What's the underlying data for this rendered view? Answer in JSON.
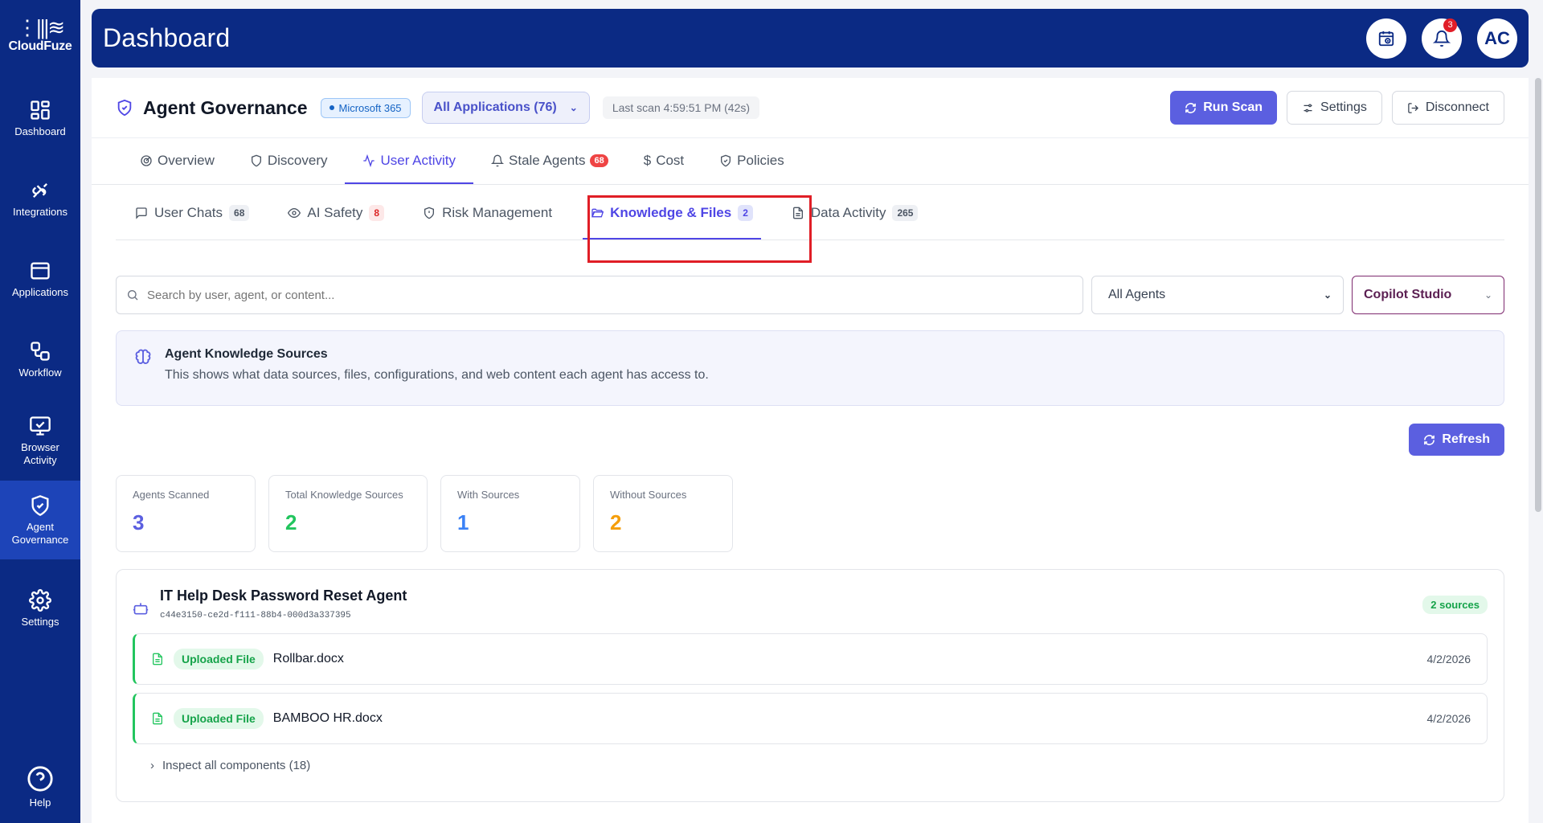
{
  "brand": {
    "name": "CloudFuze"
  },
  "sidebar": {
    "items": [
      {
        "label": "Dashboard",
        "icon": "grid-icon"
      },
      {
        "label": "Integrations",
        "icon": "plug-icon"
      },
      {
        "label": "Applications",
        "icon": "window-icon"
      },
      {
        "label": "Workflow",
        "icon": "workflow-icon"
      },
      {
        "label": "Browser Activity",
        "icon": "monitor-check-icon"
      },
      {
        "label": "Agent Governance",
        "icon": "shield-check-icon",
        "active": true
      },
      {
        "label": "Settings",
        "icon": "gear-icon"
      }
    ],
    "help": "Help"
  },
  "header": {
    "title": "Dashboard",
    "notifications": "3",
    "avatar": "AC"
  },
  "agent_bar": {
    "title": "Agent Governance",
    "platform": "Microsoft 365",
    "app_filter": "All Applications (76)",
    "last_scan": "Last scan 4:59:51 PM (42s)",
    "run_scan": "Run Scan",
    "settings": "Settings",
    "disconnect": "Disconnect"
  },
  "tabs": [
    {
      "label": "Overview"
    },
    {
      "label": "Discovery"
    },
    {
      "label": "User Activity",
      "active": true
    },
    {
      "label": "Stale Agents",
      "badge": "68"
    },
    {
      "label": "Cost"
    },
    {
      "label": "Policies"
    }
  ],
  "subtabs": [
    {
      "label": "User Chats",
      "count": "68"
    },
    {
      "label": "AI Safety",
      "count": "8"
    },
    {
      "label": "Risk Management"
    },
    {
      "label": "Knowledge & Files",
      "count": "2",
      "active": true
    },
    {
      "label": "Data Activity",
      "count": "265"
    }
  ],
  "filters": {
    "search_placeholder": "Search by user, agent, or content...",
    "agent_select": "All Agents",
    "studio_select": "Copilot Studio"
  },
  "info": {
    "title": "Agent Knowledge Sources",
    "text": "This shows what data sources, files, configurations, and web content each agent has access to."
  },
  "refresh": "Refresh",
  "stats": [
    {
      "label": "Agents Scanned",
      "value": "3",
      "color": "#5b5fe0"
    },
    {
      "label": "Total Knowledge Sources",
      "value": "2",
      "color": "#22c55e"
    },
    {
      "label": "With Sources",
      "value": "1",
      "color": "#3b82f6"
    },
    {
      "label": "Without Sources",
      "value": "2",
      "color": "#f59e0b"
    }
  ],
  "agent": {
    "name": "IT Help Desk Password Reset Agent",
    "id": "c44e3150-ce2d-f111-88b4-000d3a337395",
    "sources_badge": "2 sources",
    "files": [
      {
        "tag": "Uploaded File",
        "name": "Rollbar.docx",
        "date": "4/2/2026"
      },
      {
        "tag": "Uploaded File",
        "name": "BAMBOO HR.docx",
        "date": "4/2/2026"
      }
    ],
    "inspect": "Inspect all components (18)"
  }
}
